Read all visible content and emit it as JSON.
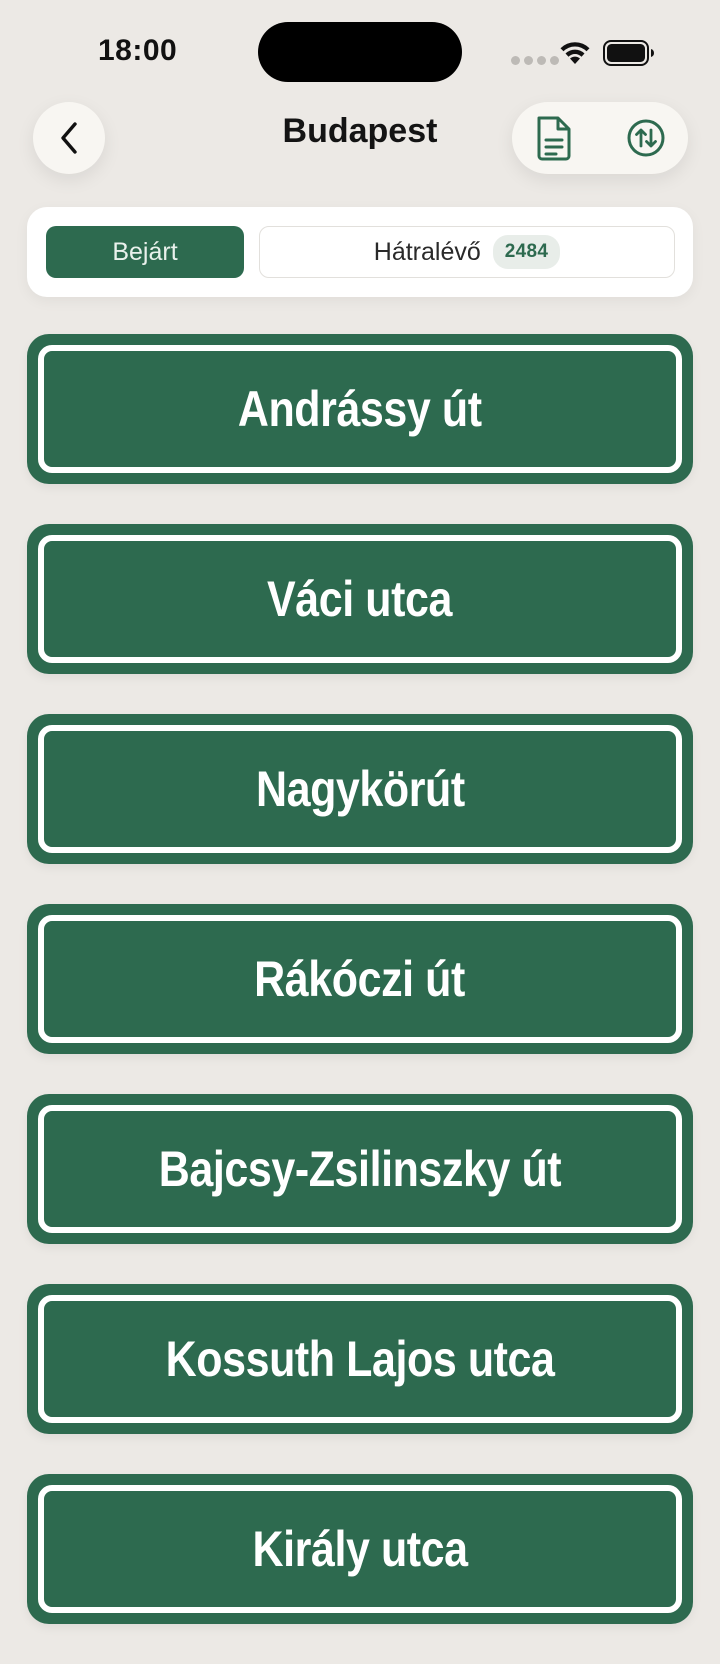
{
  "status_bar": {
    "time": "18:00"
  },
  "header": {
    "title": "Budapest",
    "back_icon": "chevron-left-icon",
    "document_icon": "document-icon",
    "sort_icon": "arrow-up-down-circle-icon"
  },
  "segments": {
    "visited_label": "Bejárt",
    "remaining_label": "Hátralévő",
    "remaining_count": "2484"
  },
  "streets": [
    "Andrássy út",
    "Váci utca",
    "Nagykörút",
    "Rákóczi út",
    "Bajcsy-Zsilinszky út",
    "Kossuth Lajos utca",
    "Király utca"
  ],
  "colors": {
    "accent": "#2D6A4F",
    "background": "#ECE9E5",
    "card": "#FFFFFF"
  }
}
